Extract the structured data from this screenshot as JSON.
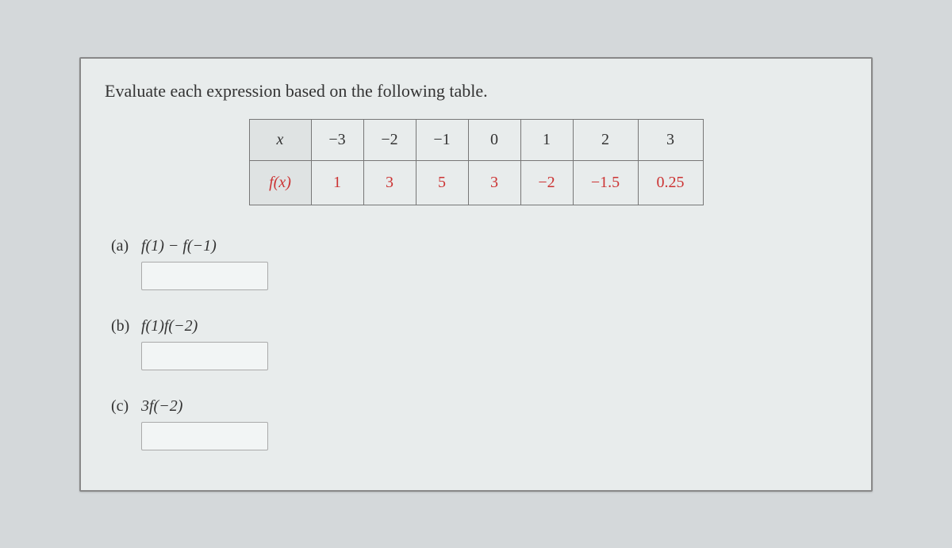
{
  "instruction": "Evaluate each expression based on the following table.",
  "table": {
    "row1_label": "x",
    "row1_values": [
      "−3",
      "−2",
      "−1",
      "0",
      "1",
      "2",
      "3"
    ],
    "row2_label": "f(x)",
    "row2_values": [
      "1",
      "3",
      "5",
      "3",
      "−2",
      "−1.5",
      "0.25"
    ]
  },
  "questions": {
    "a": {
      "label": "(a)",
      "expr": "f(1) − f(−1)"
    },
    "b": {
      "label": "(b)",
      "expr": "f(1)f(−2)"
    },
    "c": {
      "label": "(c)",
      "expr": "3f(−2)"
    }
  },
  "chart_data": {
    "type": "table",
    "columns": [
      "x",
      "f(x)"
    ],
    "rows": [
      [
        -3,
        1
      ],
      [
        -2,
        3
      ],
      [
        -1,
        5
      ],
      [
        0,
        3
      ],
      [
        1,
        -2
      ],
      [
        2,
        -1.5
      ],
      [
        3,
        0.25
      ]
    ]
  }
}
